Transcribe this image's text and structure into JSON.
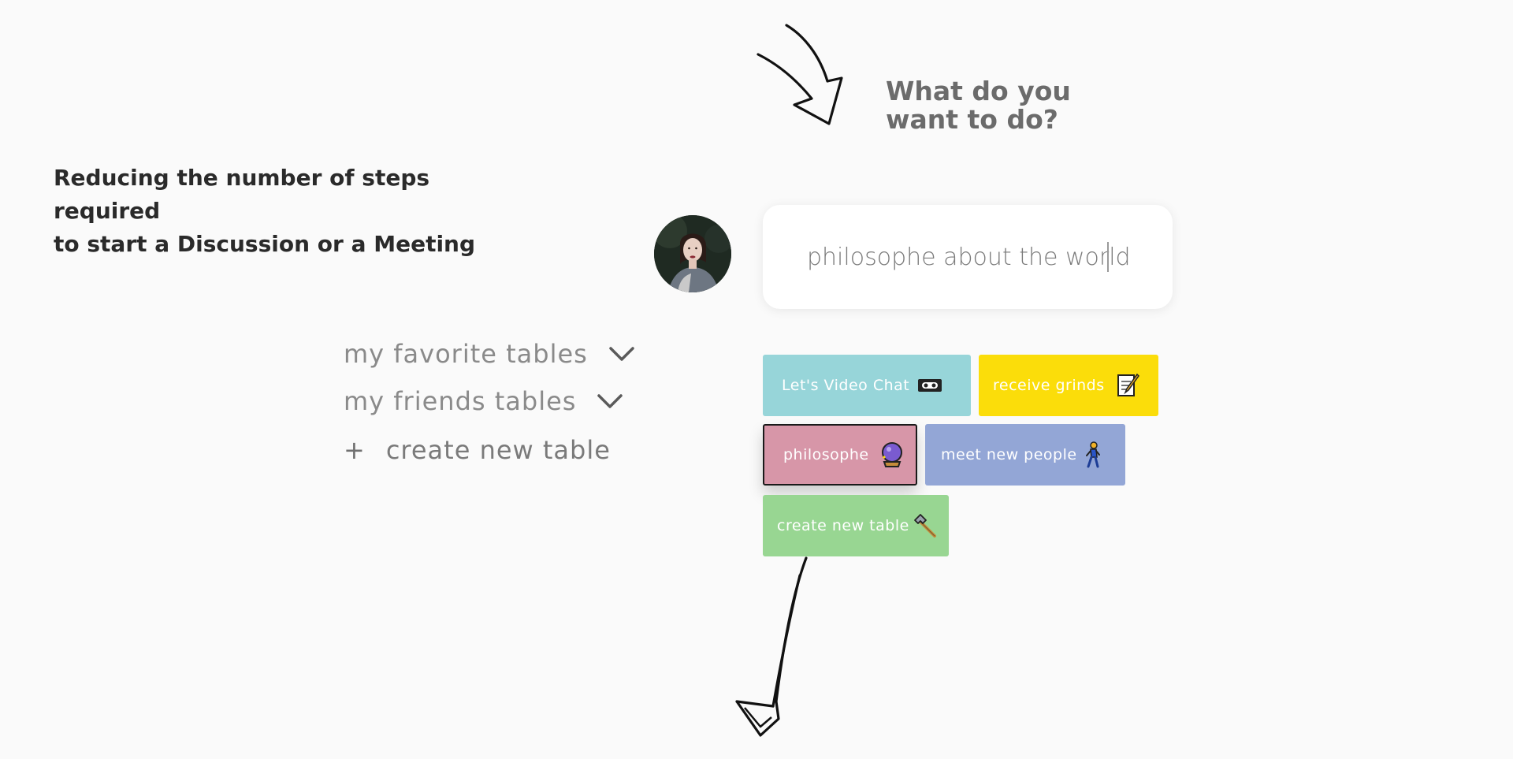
{
  "heading": {
    "line1": "What do you",
    "line2": "want to do?"
  },
  "description": {
    "line1": "Reducing the number of steps required",
    "line2": "to start a Discussion or a Meeting"
  },
  "input": {
    "value": "philosophe about the world"
  },
  "menu": {
    "favorite": "my favorite tables",
    "friends": "my friends tables",
    "create_plus": "+",
    "create": "create new table"
  },
  "chips": {
    "video": {
      "label": "Let's Video Chat",
      "color": "#97d5d9",
      "icon": "videocassette-icon"
    },
    "grinds": {
      "label": "receive grinds",
      "color": "#fbdd0a",
      "icon": "memo-icon"
    },
    "philosophe": {
      "label": "philosophe",
      "color": "#d796a8",
      "icon": "crystal-ball-icon"
    },
    "meet": {
      "label": "meet new people",
      "color": "#93a6d6",
      "icon": "person-walking-icon"
    },
    "create": {
      "label": "create new table",
      "color": "#98d692",
      "icon": "hammer-icon"
    }
  },
  "colors": {
    "background": "#fafafa",
    "heading": "#6b6b6b",
    "menu_text": "#8a8a8a"
  }
}
